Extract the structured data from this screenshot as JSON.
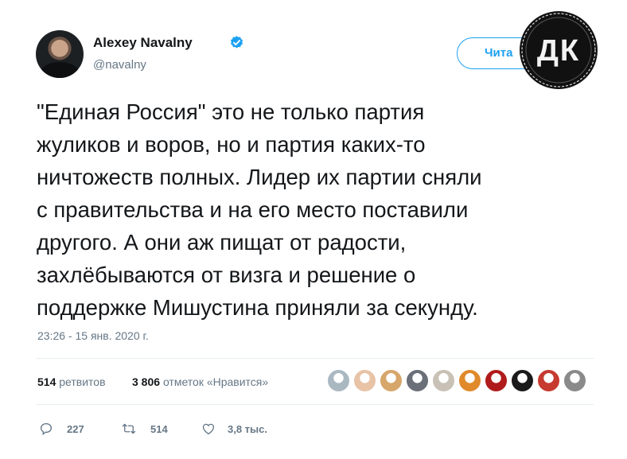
{
  "author": {
    "name": "Alexey Navalny",
    "handle": "@navalny"
  },
  "follow_button": {
    "label": "Чита"
  },
  "overlay_logo": {
    "text": "ДК"
  },
  "tweet": {
    "lines": [
      "\"Единая Россия\" это не только партия",
      "жуликов и воров, но и партия каких-то",
      "ничтожеств полных. Лидер их партии сняли",
      "с правительства и на его место поставили",
      "другого. А они аж пищат от радости,",
      "захлёбываются от визга и решение о",
      "поддержке Мишустина приняли за секунду."
    ],
    "timestamp": "23:26 - 15 янв. 2020 г."
  },
  "stats": {
    "retweets_count": "514",
    "retweets_label": "ретвитов",
    "likes_count": "3 806",
    "likes_label": "отметок «Нравится»"
  },
  "likers": [
    {
      "icon": "default-avatar",
      "color": "#aab8c2"
    },
    {
      "icon": "user-avatar",
      "color": "#e8c3a6"
    },
    {
      "icon": "dog-avatar",
      "color": "#d7a66a"
    },
    {
      "icon": "user-avatar",
      "color": "#6b6f78"
    },
    {
      "icon": "user-avatar",
      "color": "#c9c1b5"
    },
    {
      "icon": "user-avatar",
      "color": "#e08a2c"
    },
    {
      "icon": "user-avatar",
      "color": "#b01b1b"
    },
    {
      "icon": "user-avatar",
      "color": "#1a1a1a"
    },
    {
      "icon": "user-avatar",
      "color": "#c63a2f"
    },
    {
      "icon": "user-avatar",
      "color": "#8a8a8a"
    }
  ],
  "actions": {
    "replies": "227",
    "retweets": "514",
    "likes": "3,8 тыс."
  },
  "colors": {
    "accent": "#1da1f2",
    "text": "#14171a",
    "muted": "#657786",
    "divider": "#e6ecf0"
  }
}
